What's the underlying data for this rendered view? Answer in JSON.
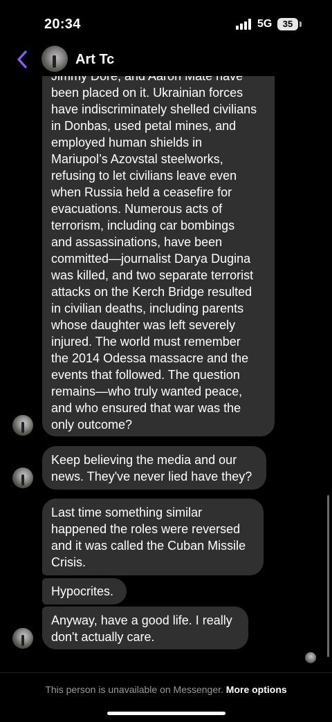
{
  "status_bar": {
    "time": "20:34",
    "network": "5G",
    "battery": "35"
  },
  "header": {
    "contact_name": "Art Tc",
    "back_icon": "chevron-left-icon",
    "accent_color": "#8a5cf6"
  },
  "messages": [
    {
      "sender": "contact",
      "text": "Jimmy Dore, and Aaron Maté have\nbeen placed on it. Ukrainian forces\nhave indiscriminately shelled civilians\nin Donbas, used petal mines, and\nemployed human shields in\nMariupol’s Azovstal steelworks,\nrefusing to let civilians leave even\nwhen Russia held a ceasefire for\nevacuations. Numerous acts of\nterrorism, including car bombings\nand assassinations, have been\ncommitted—journalist Darya Dugina\nwas killed, and two separate terrorist\nattacks on the Kerch Bridge resulted\nin civilian deaths, including parents\nwhose daughter was left severely\ninjured. The world must remember\nthe 2014 Odessa massacre and the\nevents that followed. The question\nremains—who truly wanted peace,\nand who ensured that war was the\nonly outcome?"
    },
    {
      "sender": "contact",
      "text": "Keep believing the media and our\nnews. They've never lied have they?"
    },
    {
      "sender": "contact",
      "text": "Last time something similar\nhappened the roles were reversed\nand it was called the Cuban Missile\nCrisis."
    },
    {
      "sender": "contact",
      "text": "Hypocrites."
    },
    {
      "sender": "contact",
      "text": "Anyway, have a good life. I really\ndon't actually care."
    }
  ],
  "footer": {
    "notice": "This person is unavailable on Messenger.",
    "link": "More options"
  }
}
